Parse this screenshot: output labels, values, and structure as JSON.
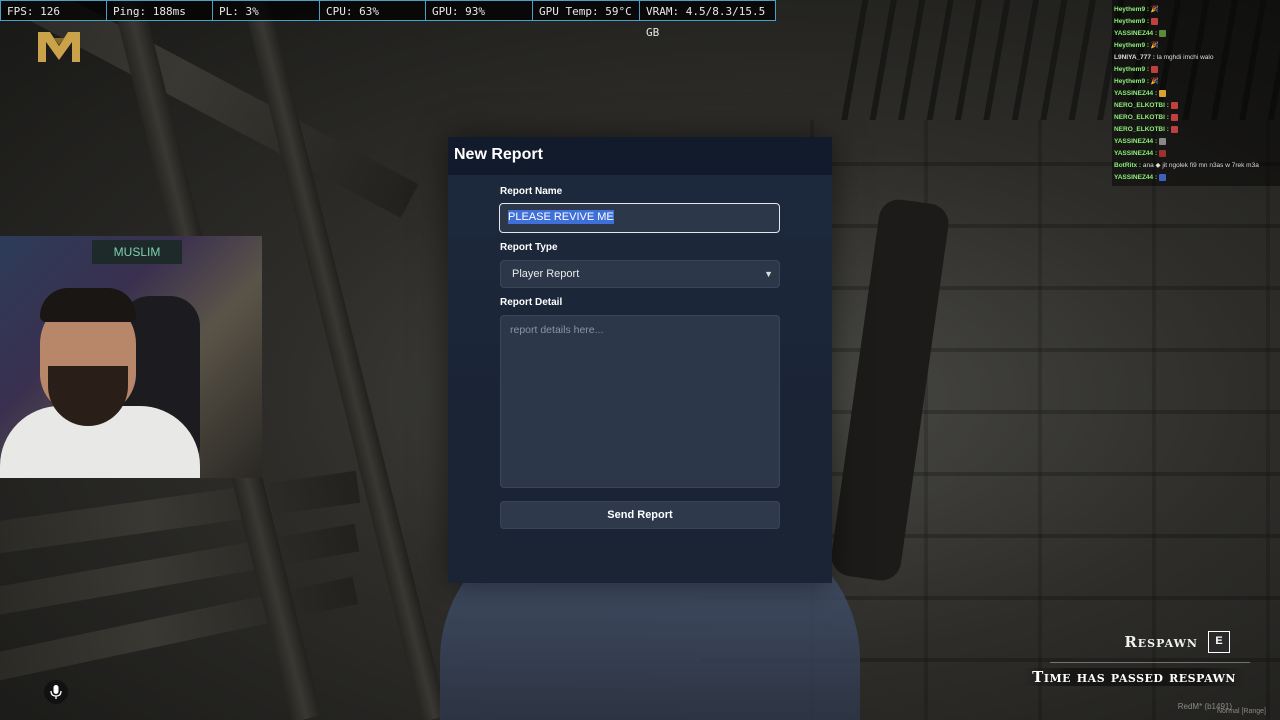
{
  "stats": [
    {
      "label": "FPS: 126"
    },
    {
      "label": "Ping: 188ms"
    },
    {
      "label": "PL: 3%"
    },
    {
      "label": "CPU: 63%"
    },
    {
      "label": "GPU: 93%"
    },
    {
      "label": "GPU Temp: 59°C"
    },
    {
      "label": "VRAM: 4.5/8.3/15.5 GB"
    }
  ],
  "chat": [
    {
      "user": "Heythem9 :",
      "msg": "🎉"
    },
    {
      "user": "Heythem9 :",
      "msg": ""
    },
    {
      "user": "YASSINEZ44 :",
      "msg": ""
    },
    {
      "user": "Heythem9 :",
      "msg": "🎉"
    },
    {
      "user": "L9NIYA_777 :",
      "msg": "la mghdi imchi walo"
    },
    {
      "user": "Heythem9 :",
      "msg": ""
    },
    {
      "user": "Heythem9 :",
      "msg": "🎉"
    },
    {
      "user": "YASSINEZ44 :",
      "msg": ""
    },
    {
      "user": "NERO_ELKOTBI :",
      "msg": ""
    },
    {
      "user": "NERO_ELKOTBI :",
      "msg": ""
    },
    {
      "user": "NERO_ELKOTBI :",
      "msg": ""
    },
    {
      "user": "YASSINEZ44 :",
      "msg": ""
    },
    {
      "user": "YASSINEZ44 :",
      "msg": ""
    },
    {
      "user": "BotRitx :",
      "msg": "ana ◆ jit ngolek fi9 mn n3as w 7rek m3a"
    },
    {
      "user": "YASSINEZ44 :",
      "msg": ""
    }
  ],
  "modal": {
    "title": "New Report",
    "name_label": "Report Name",
    "name_value": "PLEASE REVIVE ME",
    "type_label": "Report Type",
    "type_value": "Player Report",
    "detail_label": "Report Detail",
    "detail_placeholder": "report details here...",
    "send_label": "Send Report"
  },
  "hud": {
    "respawn_label": "Respawn",
    "respawn_key": "E",
    "time_passed": "Time has passed respawn",
    "watermark": "RedM* (b1491)",
    "voice_mode": "Normal [Range]"
  },
  "webcam": {
    "sign_text": "MUSLIM"
  },
  "colors": {
    "accent_select": "#3f6fd8",
    "stat_border": "#4aa0c8",
    "chat_user": "#8ff07a"
  }
}
